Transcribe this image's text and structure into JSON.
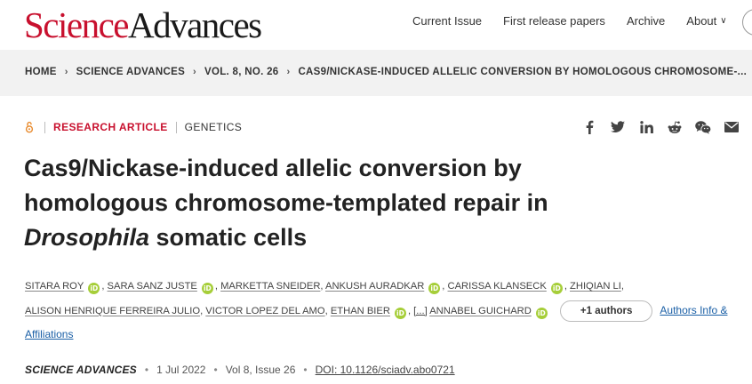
{
  "header": {
    "logo_science": "Science",
    "logo_advances": "Advances",
    "nav": [
      "Current Issue",
      "First release papers",
      "Archive"
    ],
    "about_label": "About",
    "about_chevron": "∨"
  },
  "breadcrumb": {
    "items": [
      "HOME",
      "SCIENCE ADVANCES",
      "VOL. 8, NO. 26"
    ],
    "current": "CAS9/NICKASE-INDUCED ALLELIC CONVERSION BY HOMOLOGOUS CHROMOSOME-...",
    "separator": "›"
  },
  "article_meta": {
    "access_icon": "open-access-icon",
    "type": "RESEARCH ARTICLE",
    "subject": "GENETICS"
  },
  "share_icons": [
    "facebook-icon",
    "twitter-icon",
    "linkedin-icon",
    "reddit-icon",
    "wechat-icon",
    "email-icon"
  ],
  "title": {
    "line1": "Cas9/Nickase-induced allelic conversion by",
    "line2": "homologous chromosome-templated repair in",
    "line3_italic": "Drosophila",
    "line3_rest": " somatic cells"
  },
  "authors": {
    "list": [
      "SITARA ROY",
      "SARA SANZ JUSTE",
      "MARKETTA SNEIDER",
      "ANKUSH AURADKAR",
      "CARISSA KLANSECK",
      "ZHIQIAN LI",
      "ALISON HENRIQUE FERREIRA JULIO",
      "VICTOR LOPEZ DEL AMO",
      "ETHAN BIER",
      "ANNABEL GUICHARD"
    ],
    "orcid_label": "iD",
    "ellipsis": "[...]",
    "more_button": "+1 authors",
    "affiliations_link": "Authors Info & Affiliations"
  },
  "journal_line": {
    "name": "SCIENCE ADVANCES",
    "date": "1 Jul 2022",
    "volume": "Vol 8, Issue 26",
    "doi": "DOI: 10.1126/sciadv.abo0721",
    "separator": "•"
  },
  "colors": {
    "brand_red": "#c8102e",
    "orcid_green": "#a6ce39",
    "link_blue": "#1a5fa6",
    "crumb_bg": "#f2f2f2"
  }
}
